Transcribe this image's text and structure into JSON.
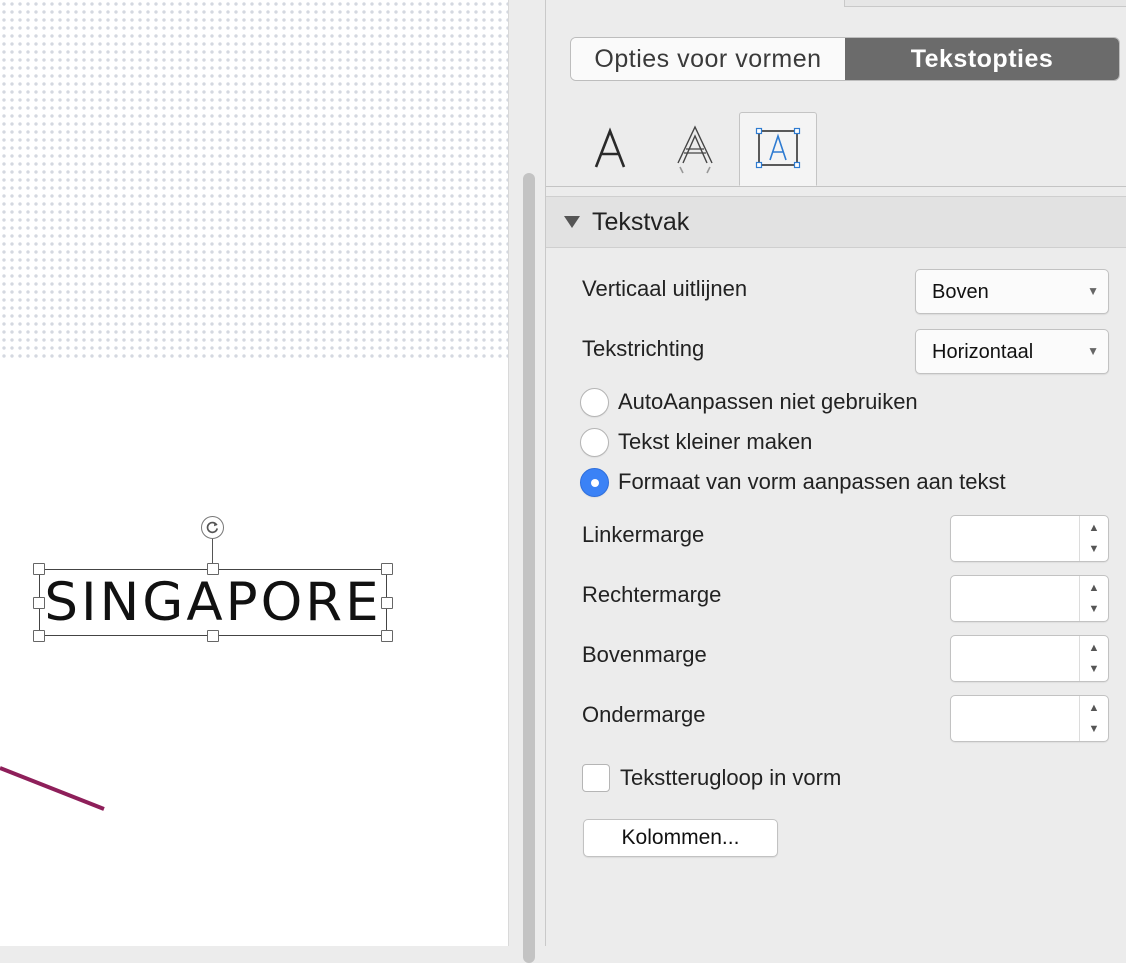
{
  "canvas": {
    "textbox_text": "SINGAPORE",
    "accent_line_color": "#8e1f5a"
  },
  "panel": {
    "tabs": [
      "Opties voor vormen",
      "Tekstopties"
    ],
    "active_tab": "Tekstopties",
    "icon_tabs": [
      {
        "name": "text-fill-icon",
        "glyph": "A"
      },
      {
        "name": "text-outline-effects-icon",
        "glyph": "A"
      },
      {
        "name": "textbox-layout-icon",
        "glyph": "A"
      }
    ],
    "active_icon_tab": "textbox-layout-icon",
    "section_title": "Tekstvak",
    "vertical_align": {
      "label": "Verticaal uitlijnen",
      "value": "Boven"
    },
    "text_direction": {
      "label": "Tekstrichting",
      "value": "Horizontaal"
    },
    "autofit_options": [
      {
        "label": "AutoAanpassen niet gebruiken",
        "selected": false
      },
      {
        "label": "Tekst kleiner maken",
        "selected": false
      },
      {
        "label": "Formaat van vorm aanpassen aan tekst",
        "selected": true
      }
    ],
    "margins": [
      {
        "label": "Linkermarge",
        "value": ""
      },
      {
        "label": "Rechtermarge",
        "value": ""
      },
      {
        "label": "Bovenmarge",
        "value": ""
      },
      {
        "label": "Ondermarge",
        "value": ""
      }
    ],
    "wrap_text": {
      "label": "Tekstterugloop in vorm",
      "checked": false
    },
    "columns_button": "Kolommen..."
  },
  "colors": {
    "accent_blue": "#3b82f6",
    "active_tab_bg": "#6b6b6b"
  }
}
